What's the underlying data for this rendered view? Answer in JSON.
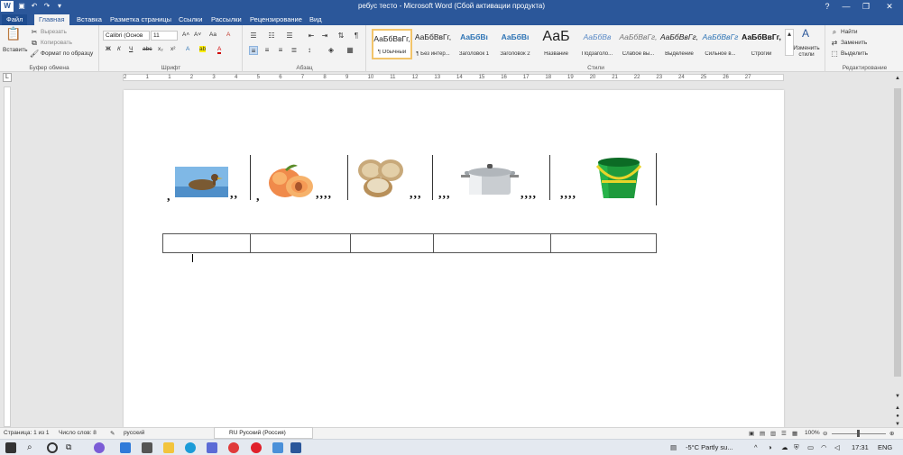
{
  "window": {
    "title": "ребус тесто  -  Microsoft Word (Сбой активации продукта)",
    "app_icon": "W",
    "close": "✕",
    "maximize": "❐",
    "minimize": "—",
    "help": "?"
  },
  "tabs": [
    "Файл",
    "Главная",
    "Вставка",
    "Разметка страницы",
    "Ссылки",
    "Рассылки",
    "Рецензирование",
    "Вид"
  ],
  "clipboard": {
    "paste": "Вставить",
    "cut": "Вырезать",
    "copy": "Копировать",
    "format_painter": "Формат по образцу",
    "label": "Буфер обмена"
  },
  "font": {
    "name": "Calibri (Основ",
    "size": "11",
    "label": "Шрифт",
    "bold": "Ж",
    "italic": "К",
    "underline": "Ч",
    "strike": "abc",
    "sub": "x₂",
    "sup": "x²",
    "grow": "A˄",
    "shrink": "A˅",
    "case": "Aa",
    "clear": "A",
    "highlight": "ab",
    "color": "A"
  },
  "paragraph": {
    "label": "Абзац"
  },
  "styles": {
    "label": "Стили",
    "items": [
      {
        "preview": "АаБбВвГг,",
        "name": "¶ Обычный",
        "color": "#222222"
      },
      {
        "preview": "АаБбВвГг,",
        "name": "¶ Без интер...",
        "color": "#222222"
      },
      {
        "preview": "АаБбВı",
        "name": "Заголовок 1",
        "color": "#2e74b5"
      },
      {
        "preview": "АаБбВı",
        "name": "Заголовок 2",
        "color": "#2e74b5"
      },
      {
        "preview": "АаБ",
        "name": "Название",
        "color": "#222222"
      },
      {
        "preview": "АаБбВв",
        "name": "Подзаголо...",
        "color": "#5a8ac6"
      },
      {
        "preview": "АаБбВвГг,",
        "name": "Слабое вы...",
        "color": "#777777"
      },
      {
        "preview": "АаБбВвГг,",
        "name": "Выделение",
        "color": "#222222"
      },
      {
        "preview": "АаБбВвГг",
        "name": "Сильное в...",
        "color": "#2e74b5"
      },
      {
        "preview": "АаБбВвГг,",
        "name": "Строгий",
        "color": "#111111"
      }
    ],
    "change": "Изменить стили"
  },
  "editing": {
    "find": "Найти",
    "replace": "Заменить",
    "select": "Выделить",
    "label": "Редактирование"
  },
  "ruler": {
    "numbers": [
      "2",
      "1",
      "1",
      "2",
      "3",
      "4",
      "5",
      "6",
      "7",
      "8",
      "9",
      "10",
      "11",
      "12",
      "13",
      "14",
      "15",
      "16",
      "17",
      "18",
      "19",
      "20",
      "21",
      "22",
      "23",
      "24",
      "25",
      "26",
      "27"
    ]
  },
  "rebus": {
    "commas": [
      ",",
      ",,",
      ",",
      ",,,,",
      ",,,",
      ",,,",
      ",,,,",
      ",,,,"
    ]
  },
  "status": {
    "page": "Страница: 1 из 1",
    "words": "Число слов: 8",
    "lang": "русский",
    "zoom": "100%"
  },
  "lang_popup": "RU Русский (Россия)",
  "taskbar": {
    "weather": "-5°C  Partly su...",
    "time": "17:31",
    "lang": "ENG"
  }
}
